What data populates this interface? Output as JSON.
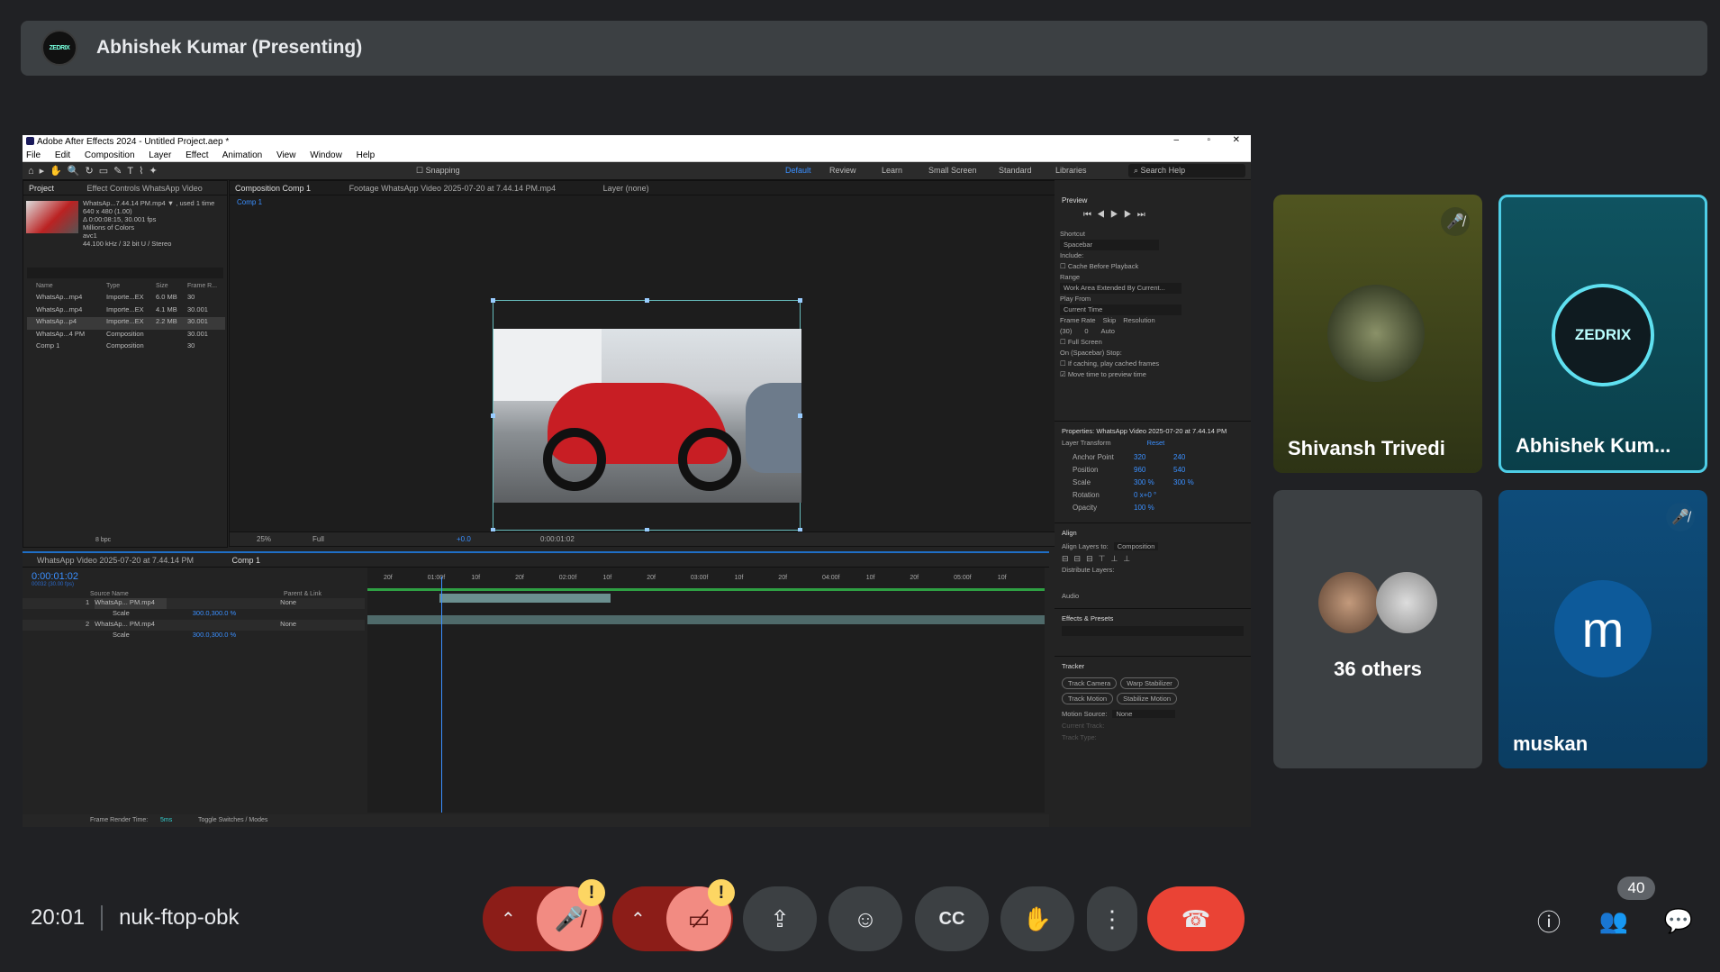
{
  "presenter": {
    "name": "Abhishek Kumar (Presenting)",
    "avatar_text": "ZEDRIX"
  },
  "ae": {
    "title": "Adobe After Effects 2024 - Untitled Project.aep *",
    "menu": [
      "File",
      "Edit",
      "Composition",
      "Layer",
      "Effect",
      "Animation",
      "View",
      "Window",
      "Help"
    ],
    "snapping": "Snapping",
    "workspaces": [
      "Default",
      "Review",
      "Learn",
      "Small Screen",
      "Standard",
      "Libraries"
    ],
    "search_help": "Search Help",
    "project_tab": "Project",
    "effect_controls_tab": "Effect Controls WhatsApp Video",
    "project_info": [
      "WhatsAp...7.44.14 PM.mp4 ▼ , used 1 time",
      "640 x 480 (1.00)",
      "Δ 0:00:08:15, 30.001 fps",
      "Millions of Colors",
      "avc1",
      "44.100 kHz / 32 bit U / Stereo"
    ],
    "project_cols": [
      "Name",
      "Type",
      "Size",
      "Frame R..."
    ],
    "project_rows": [
      {
        "name": "WhatsAp...mp4",
        "type": "Importe...EX",
        "size": "6.0 MB",
        "fr": "30"
      },
      {
        "name": "WhatsAp...mp4",
        "type": "Importe...EX",
        "size": "4.1 MB",
        "fr": "30.001"
      },
      {
        "name": "WhatsAp...p4",
        "type": "Importe...EX",
        "size": "2.2 MB",
        "fr": "30.001"
      },
      {
        "name": "WhatsAp...4 PM",
        "type": "Composition",
        "size": "",
        "fr": "30.001"
      },
      {
        "name": "Comp 1",
        "type": "Composition",
        "size": "",
        "fr": "30"
      }
    ],
    "bpc": "8 bpc",
    "comp_tab": "Composition Comp 1",
    "footage_tab": "Footage WhatsApp Video 2025-07-20 at 7.44.14 PM.mp4",
    "layer_tab": "Layer (none)",
    "comp_breadcrumb": "Comp 1",
    "zoom": "25%",
    "resolution": "Full",
    "exposure": "+0.0",
    "viewer_time": "0:00:01:02",
    "timeline_tabs": [
      "WhatsApp Video 2025-07-20 at 7.44.14 PM",
      "Comp 1"
    ],
    "timecode": "0:00:01:02",
    "timecode_sub": "00032 (30.00 fps)",
    "tl_cols": [
      "Source Name",
      "Parent & Link"
    ],
    "ruler": [
      "20f",
      "01:00f",
      "10f",
      "20f",
      "02:00f",
      "10f",
      "20f",
      "03:00f",
      "10f",
      "20f",
      "04:00f",
      "10f",
      "20f",
      "05:00f",
      "10f"
    ],
    "layers": [
      {
        "num": "1",
        "name": "WhatsAp... PM.mp4",
        "parent": "None",
        "prop": "Scale",
        "val": "300.0,300.0 %"
      },
      {
        "num": "2",
        "name": "WhatsAp... PM.mp4",
        "parent": "None",
        "prop": "Scale",
        "val": "300.0,300.0 %"
      }
    ],
    "frame_render": "Frame Render Time:",
    "frame_render_val": "5ms",
    "toggle_switches": "Toggle Switches / Modes",
    "preview": {
      "title": "Preview",
      "shortcut_label": "Shortcut",
      "shortcut": "Spacebar",
      "include": "Include:",
      "cache": "Cache Before Playback",
      "range_label": "Range",
      "range": "Work Area Extended By Current...",
      "play_from_label": "Play From",
      "play_from": "Current Time",
      "frame_rate_label": "Frame Rate",
      "skip_label": "Skip",
      "resolution_label": "Resolution",
      "frame_rate": "(30)",
      "skip": "0",
      "resolution": "Auto",
      "full_screen": "Full Screen",
      "on_stop": "On (Spacebar) Stop:",
      "if_caching": "If caching, play cached frames",
      "move_time": "Move time to preview time"
    },
    "properties": {
      "title": "Properties: WhatsApp Video 2025-07-20 at 7.44.14 PM",
      "layer_transform": "Layer Transform",
      "reset": "Reset",
      "rows": [
        {
          "label": "Anchor Point",
          "v1": "320",
          "v2": "240"
        },
        {
          "label": "Position",
          "v1": "960",
          "v2": "540"
        },
        {
          "label": "Scale",
          "v1": "300 %",
          "v2": "300 %"
        },
        {
          "label": "Rotation",
          "v1": "0 x+0 °",
          "v2": ""
        },
        {
          "label": "Opacity",
          "v1": "100 %",
          "v2": ""
        }
      ]
    },
    "align": {
      "title": "Align",
      "layers_to": "Align Layers to:",
      "target": "Composition",
      "distribute": "Distribute Layers:"
    },
    "audio": "Audio",
    "effects": "Effects & Presets",
    "tracker": {
      "title": "Tracker",
      "buttons": [
        "Track Camera",
        "Warp Stabilizer",
        "Track Motion",
        "Stabilize Motion"
      ],
      "motion_source": "Motion Source:",
      "source": "None",
      "current_track": "Current Track:",
      "track_type": "Track Type:"
    }
  },
  "tiles": [
    {
      "name": "Shivansh Trivedi",
      "muted": true
    },
    {
      "name": "Abhishek Kum...",
      "avatar_text": "ZEDRIX",
      "active": true
    },
    {
      "name": "36 others"
    },
    {
      "name": "muskan",
      "initial": "m",
      "muted": true
    }
  ],
  "meeting": {
    "time": "20:01",
    "code": "nuk-ftop-obk",
    "participants": "40"
  },
  "colors": {
    "bg": "#202124",
    "end_call": "#ea4335",
    "muted_btn": "#f28b82",
    "active_border": "#4ecde6",
    "warn": "#fdd663"
  }
}
